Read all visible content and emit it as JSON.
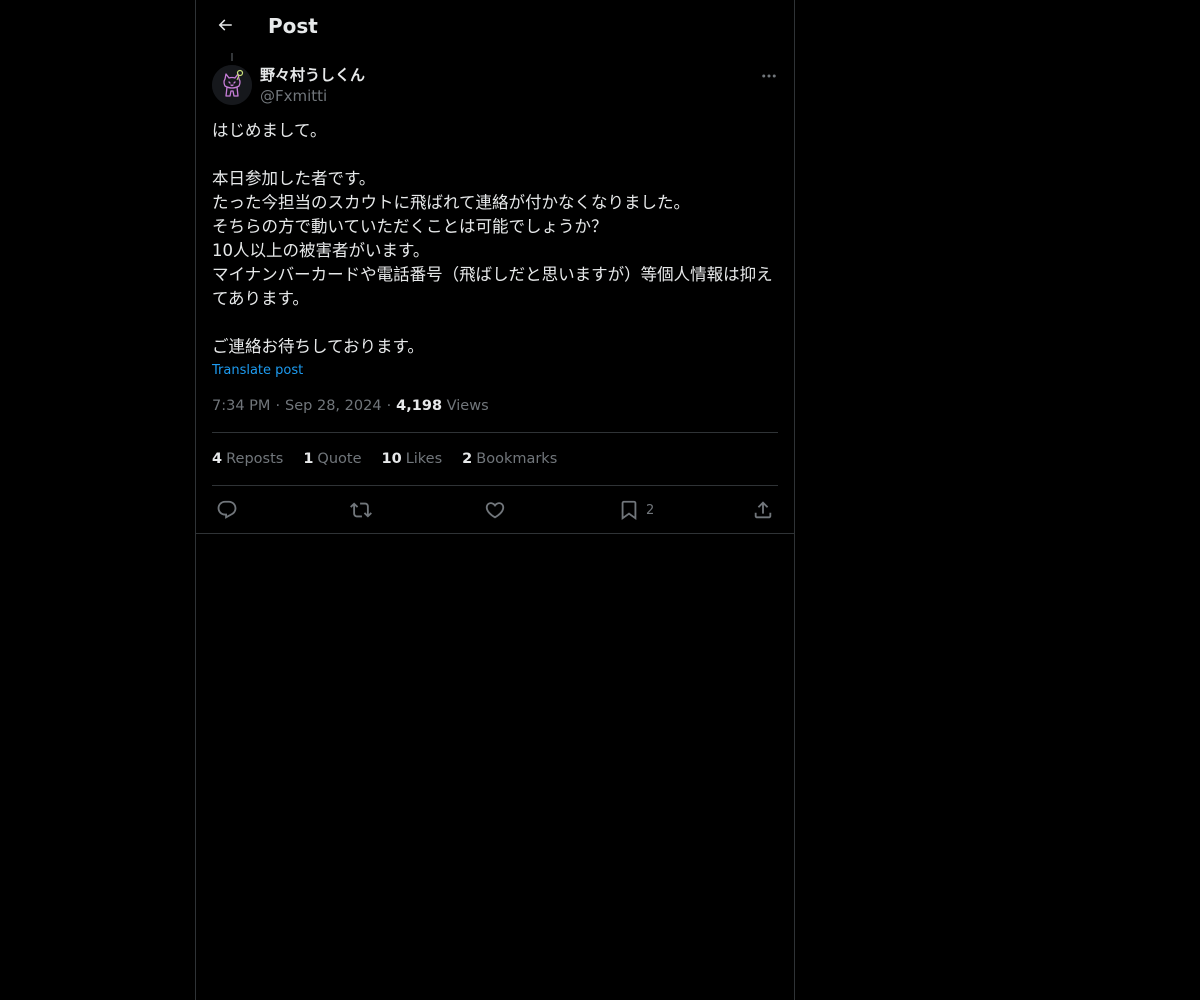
{
  "header": {
    "title": "Post"
  },
  "author": {
    "display_name": "野々村うしくん",
    "handle": "@Fxmitti"
  },
  "post": {
    "text": "はじめまして。\n\n本日参加した者です。\nたった今担当のスカウトに飛ばれて連絡が付かなくなりました。\nそちらの方で動いていただくことは可能でしょうか？\n10人以上の被害者がいます。\nマイナンバーカードや電話番号（飛ばしだと思いますが）等個人情報は抑えてあります。\n\nご連絡お待ちしております。",
    "translate_label": "Translate post",
    "time": "7:34 PM",
    "date": "Sep 28, 2024",
    "views_count": "4,198",
    "views_label": "Views"
  },
  "stats": {
    "reposts": {
      "count": "4",
      "label": "Reposts"
    },
    "quotes": {
      "count": "1",
      "label": "Quote"
    },
    "likes": {
      "count": "10",
      "label": "Likes"
    },
    "bookmarks": {
      "count": "2",
      "label": "Bookmarks"
    }
  },
  "actions": {
    "bookmark_count": "2",
    "icons": [
      "reply-icon",
      "repost-icon",
      "like-icon",
      "bookmark-icon",
      "share-icon"
    ]
  },
  "colors": {
    "background": "#000000",
    "text": "#e7e9ea",
    "muted": "#71767b",
    "link": "#1d9bf0",
    "border": "#2f3336"
  }
}
